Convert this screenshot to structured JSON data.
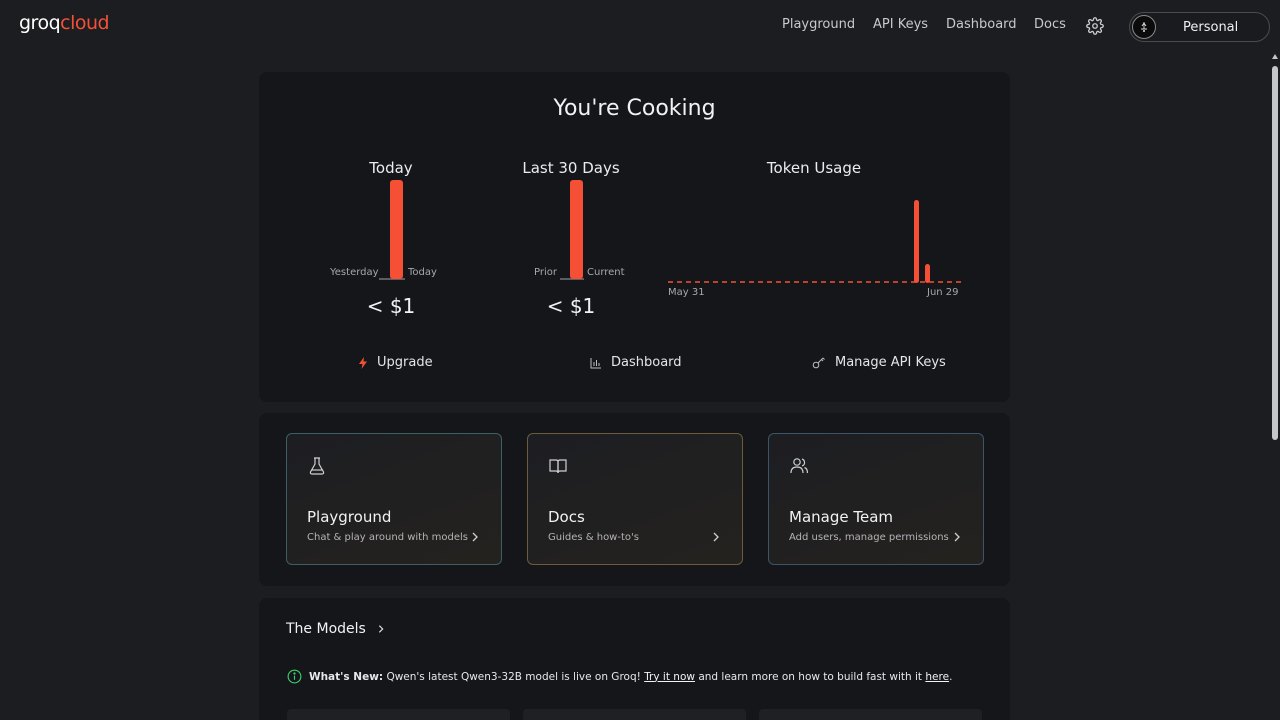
{
  "header": {
    "logo_main": "groq",
    "logo_accent": "cloud",
    "nav": [
      "Playground",
      "API Keys",
      "Dashboard",
      "Docs"
    ],
    "profile_label": "Personal"
  },
  "usage": {
    "title": "You're Cooking",
    "today": {
      "title": "Today",
      "left_label": "Yesterday",
      "right_label": "Today",
      "amount": "< $1"
    },
    "last30": {
      "title": "Last 30 Days",
      "left_label": "Prior",
      "right_label": "Current",
      "amount": "< $1"
    },
    "tokens": {
      "title": "Token Usage",
      "start_label": "May 31",
      "end_label": "Jun 29"
    }
  },
  "chart_data": [
    {
      "type": "bar",
      "title": "Today",
      "categories": [
        "Yesterday",
        "Today"
      ],
      "values": [
        0,
        1
      ]
    },
    {
      "type": "bar",
      "title": "Last 30 Days",
      "categories": [
        "Prior",
        "Current"
      ],
      "values": [
        0,
        1
      ]
    },
    {
      "type": "bar",
      "title": "Token Usage",
      "x": [
        "May 31",
        "Jun 29"
      ],
      "values_relative": [
        0,
        0,
        0,
        0,
        0,
        0,
        0,
        0,
        0,
        0,
        0,
        0,
        0,
        0,
        0,
        0,
        0,
        0,
        0,
        0,
        0,
        0,
        0,
        0,
        0,
        0,
        0,
        0,
        1.0,
        0.22
      ]
    }
  ],
  "actions": {
    "upgrade": "Upgrade",
    "dashboard": "Dashboard",
    "manage_keys": "Manage API Keys"
  },
  "cards": [
    {
      "title": "Playground",
      "subtitle": "Chat & play around with models",
      "icon": "flask-icon"
    },
    {
      "title": "Docs",
      "subtitle": "Guides & how-to's",
      "icon": "book-icon"
    },
    {
      "title": "Manage Team",
      "subtitle": "Add users, manage permissions",
      "icon": "users-icon"
    }
  ],
  "models": {
    "title": "The Models",
    "news_label": "What's New:",
    "news_text_1": "Qwen's latest Qwen3-32B model is live on Groq!",
    "news_link_1": "Try it now",
    "news_text_2": "and learn more on how to build fast with it",
    "news_link_2": "here",
    "news_end": "."
  },
  "colors": {
    "accent": "#f55036",
    "background": "#1c1d21",
    "panel": "#151619",
    "info_green": "#3ecf6e"
  }
}
